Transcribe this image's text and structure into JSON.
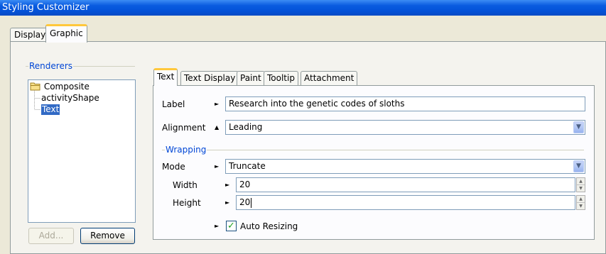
{
  "window": {
    "title": "Styling Customizer"
  },
  "outer_tabs": [
    {
      "label": "Display",
      "active": false
    },
    {
      "label": "Graphic",
      "active": true
    }
  ],
  "renderers": {
    "group_title": "Renderers",
    "tree": [
      {
        "label": "Composite",
        "icon": "folder-icon",
        "level": 0,
        "selected": false
      },
      {
        "label": "activityShape",
        "level": 1,
        "selected": false
      },
      {
        "label": "Text",
        "level": 1,
        "selected": true
      }
    ],
    "add_button": "Add...",
    "remove_button": "Remove"
  },
  "inner_tabs": [
    {
      "label": "Text",
      "active": true
    },
    {
      "label": "Text Display",
      "active": false
    },
    {
      "label": "Paint",
      "active": false
    },
    {
      "label": "Tooltip",
      "active": false
    },
    {
      "label": "Attachment",
      "active": false
    }
  ],
  "form": {
    "label": {
      "name": "Label",
      "value": "Research into the genetic codes of sloths"
    },
    "alignment": {
      "name": "Alignment",
      "value": "Leading"
    },
    "wrapping": {
      "group_title": "Wrapping",
      "mode": {
        "name": "Mode",
        "value": "Truncate"
      },
      "width": {
        "name": "Width",
        "value": "20"
      },
      "height": {
        "name": "Height",
        "value": "20"
      },
      "auto_resizing": {
        "name": "Auto Resizing",
        "checked": true
      }
    }
  },
  "colors": {
    "titlebar": "#0a5ce0",
    "selection": "#316ac5",
    "tab_highlight": "#ffc83c",
    "group_title": "#0046d5"
  }
}
